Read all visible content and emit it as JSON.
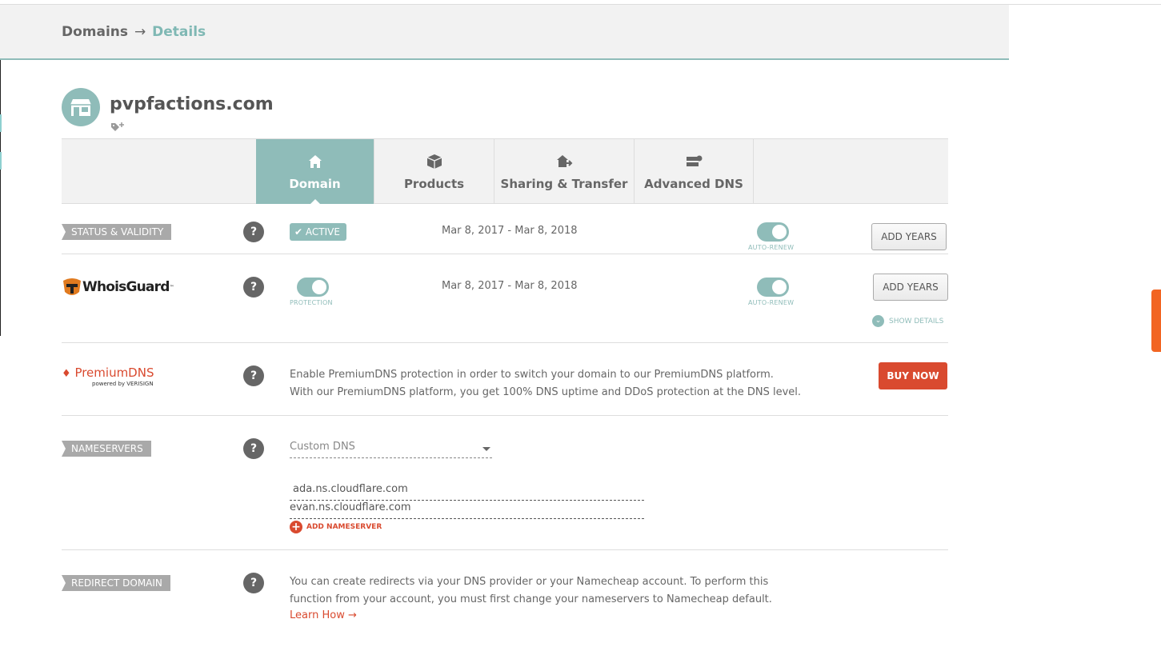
{
  "breadcrumb": {
    "root": "Domains",
    "arrow": "→",
    "current": "Details"
  },
  "domain": {
    "name": "pvpfactions.com"
  },
  "tabs": [
    {
      "label": "Domain",
      "icon": "home-icon",
      "active": true
    },
    {
      "label": "Products",
      "icon": "box-icon",
      "active": false
    },
    {
      "label": "Sharing & Transfer",
      "icon": "transfer-icon",
      "active": false
    },
    {
      "label": "Advanced DNS",
      "icon": "server-icon",
      "active": false
    }
  ],
  "status": {
    "label": "STATUS & VALIDITY",
    "badge": "ACTIVE",
    "dates": "Mar 8, 2017 - Mar 8, 2018",
    "auto_renew_label": "AUTO-RENEW",
    "add_years": "ADD YEARS"
  },
  "whoisguard": {
    "logo_text": "WhoisGuard",
    "trademark": "™",
    "protection_label": "PROTECTION",
    "dates": "Mar 8, 2017 - Mar 8, 2018",
    "auto_renew_label": "AUTO-RENEW",
    "add_years": "ADD YEARS",
    "show_details": "SHOW DETAILS"
  },
  "premiumdns": {
    "logo_text": "PremiumDNS",
    "powered_by": "powered by VERISIGN",
    "line1": "Enable PremiumDNS protection in order to switch your domain to our PremiumDNS platform.",
    "line2": "With our PremiumDNS platform, you get 100% DNS uptime and DDoS protection at the DNS level.",
    "buy_now": "BUY NOW"
  },
  "nameservers": {
    "label": "NAMESERVERS",
    "selected": "Custom DNS",
    "servers": [
      "ada.ns.cloudflare.com",
      "evan.ns.cloudflare.com"
    ],
    "add_label": "ADD NAMESERVER"
  },
  "redirect": {
    "label": "REDIRECT DOMAIN",
    "line1": "You can create redirects via your DNS provider or your Namecheap account. To perform this",
    "line2": "function from your account, you must first change your nameservers to Namecheap default.",
    "learn_how": "Learn How →"
  },
  "help_symbol": "?",
  "colors": {
    "accent": "#8fbcb9",
    "red": "#d94a2f",
    "orange": "#f26522"
  }
}
